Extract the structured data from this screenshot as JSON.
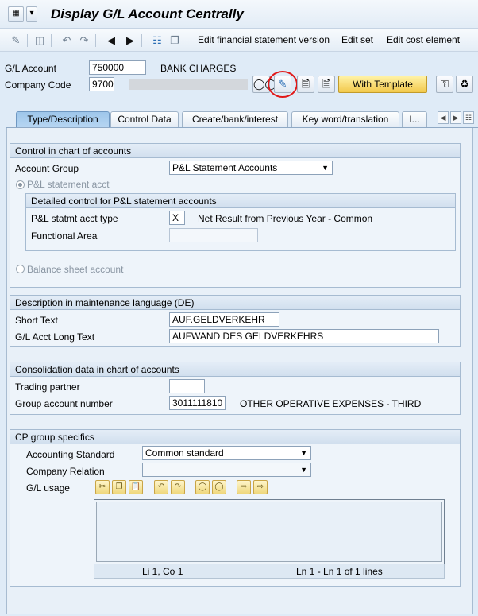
{
  "window": {
    "title": "Display G/L Account Centrally"
  },
  "toolbar": {
    "links": [
      "Edit financial statement version",
      "Edit set",
      "Edit cost element"
    ]
  },
  "header": {
    "gl_account_label": "G/L Account",
    "gl_account_value": "750000",
    "gl_account_name": "BANK CHARGES",
    "company_code_label": "Company Code",
    "company_code_value": "9700",
    "with_template_label": "With Template"
  },
  "tabs": [
    {
      "label": "Type/Description",
      "active": true
    },
    {
      "label": "Control Data",
      "active": false
    },
    {
      "label": "Create/bank/interest",
      "active": false
    },
    {
      "label": "Key word/translation",
      "active": false
    },
    {
      "label": "I...",
      "active": false
    }
  ],
  "control_group": {
    "title": "Control in chart of accounts",
    "account_group_label": "Account Group",
    "account_group_value": "P&L Statement Accounts",
    "pl_radio_label": "P&L statement acct",
    "detail_title": "Detailed control for P&L statement accounts",
    "pl_type_label": "P&L statmt acct type",
    "pl_type_value": "X",
    "pl_type_text": "Net Result from Previous Year - Common",
    "functional_area_label": "Functional Area",
    "functional_area_value": "",
    "balance_radio_label": "Balance sheet account"
  },
  "description_group": {
    "title": "Description in maintenance language (DE)",
    "short_text_label": "Short Text",
    "short_text_value": "AUF.GELDVERKEHR",
    "long_text_label": "G/L Acct Long Text",
    "long_text_value": "AUFWAND DES GELDVERKEHRS"
  },
  "consolidation_group": {
    "title": "Consolidation data in chart of accounts",
    "trading_partner_label": "Trading partner",
    "trading_partner_value": "",
    "group_account_label": "Group account number",
    "group_account_value": "3011111810",
    "group_account_text": "OTHER OPERATIVE EXPENSES - THIRD"
  },
  "cp_group": {
    "title": "CP group specifics",
    "accounting_standard_label": "Accounting Standard",
    "accounting_standard_value": "Common standard",
    "company_relation_label": "Company Relation",
    "company_relation_value": "",
    "gl_usage_label": "G/L usage",
    "editor_position": "Li 1, Co 1",
    "editor_lines": "Ln 1 - Ln 1 of 1 lines"
  },
  "colors": {
    "background": "#dfebf7",
    "active_tab": "#a9cdee",
    "highlight_circle": "#e11818",
    "template_button": "#f2c94c"
  }
}
